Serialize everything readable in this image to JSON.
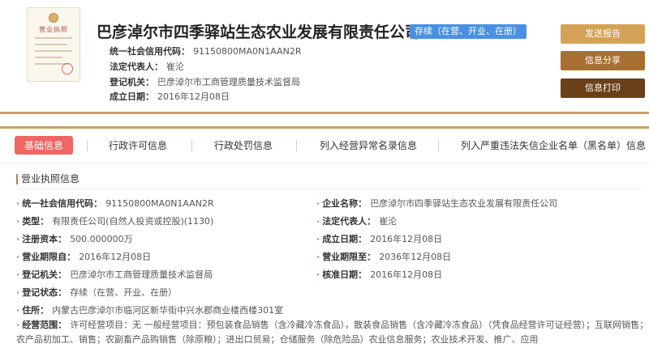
{
  "header": {
    "license_thumb_title": "营业执照",
    "company_name": "巴彦淖尔市四季驿站生态农业发展有限责任公司",
    "status_badge": "存续（在营、开业、在册）",
    "rows": [
      {
        "label": "统一社会信用代码：",
        "value": "91150800MA0N1AAN2R"
      },
      {
        "label": "法定代表人：",
        "value": "崔沦"
      },
      {
        "label": "登记机关：",
        "value": "巴彦淖尔市工商管理质量技术监督局"
      },
      {
        "label": "成立日期：",
        "value": "2016年12月08日"
      }
    ],
    "buttons": {
      "report": "发送报告",
      "share": "信息分享",
      "print": "信息打印"
    }
  },
  "tabs": [
    "基础信息",
    "行政许可信息",
    "行政处罚信息",
    "列入经营异常名录信息",
    "列入严重违法失信企业名单（黑名单）信息"
  ],
  "section_title": "营业执照信息",
  "fields": {
    "credit_code": {
      "label": "统一社会信用代码：",
      "value": "91150800MA0N1AAN2R"
    },
    "type": {
      "label": "类型：",
      "value": "有限责任公司(自然人投资或控股)(1130)"
    },
    "capital": {
      "label": "注册资本：",
      "value": "500.000000万"
    },
    "term_from": {
      "label": "营业期限自：",
      "value": "2016年12月08日"
    },
    "authority": {
      "label": "登记机关：",
      "value": "巴彦淖尔市工商管理质量技术监督局"
    },
    "status": {
      "label": "登记状态：",
      "value": "存续（在营、开业、在册）"
    },
    "address": {
      "label": "住所：",
      "value": "内蒙古巴彦淖尔市临河区新华街中兴水郡商业楼西楼301室"
    },
    "scope": {
      "label": "经营范围：",
      "value": "许可经营项目：无 一般经营项目：预包装食品销售（含冷藏冷冻食品），散装食品销售（含冷藏冷冻食品）（凭食品经营许可证经营）；互联网销售；农产品初加工、销售；农副畜产品购销售（除原粮）；进出口贸易；仓储服务（除危险品）农业信息服务；农业技术开发、推广、应用"
    },
    "company_name": {
      "label": "企业名称：",
      "value": "巴彦淖尔市四季驿站生态农业发展有限责任公司"
    },
    "legal_rep": {
      "label": "法定代表人：",
      "value": "崔沦"
    },
    "established": {
      "label": "成立日期：",
      "value": "2016年12月08日"
    },
    "term_to": {
      "label": "营业期限至：",
      "value": "2036年12月08日"
    },
    "approved": {
      "label": "核准日期：",
      "value": "2016年12月08日"
    }
  }
}
